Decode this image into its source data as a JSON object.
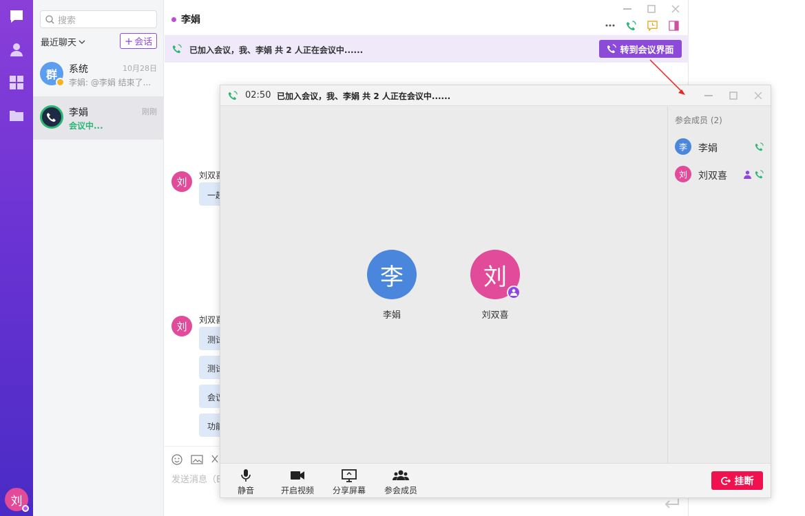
{
  "rail": {
    "me_avatar": "刘"
  },
  "chatlist": {
    "search_placeholder": "搜索",
    "recent_label": "最近聊天",
    "new_session_label": "会话",
    "conversations": [
      {
        "avatar": "群",
        "name": "系统",
        "time": "10月28日",
        "preview": "李娟: @李娟 结束了..."
      },
      {
        "avatar": "",
        "name": "李娟",
        "time": "刚刚",
        "preview": "会议中..."
      }
    ]
  },
  "chat": {
    "title": "李娟",
    "banner_text": "已加入会议，我、李娟 共 2 人正在会议中......",
    "goto_meeting_label": "转到会议界面",
    "messages": [
      {
        "avatar": "刘",
        "sender": "刘双喜",
        "bubbles": [
          "一起"
        ]
      },
      {
        "avatar": "刘",
        "sender": "刘双喜",
        "bubbles": [
          "测试",
          "测试",
          "会议",
          "功能"
        ]
      }
    ],
    "composer_placeholder": "发送消息（E"
  },
  "meeting": {
    "timer": "02:50",
    "status_text": "已加入会议，我、李娟 共 2 人正在会议中......",
    "participants": [
      {
        "avatar": "李",
        "name": "李娟",
        "color": "#4a86dc"
      },
      {
        "avatar": "刘",
        "name": "刘双喜",
        "color": "#e24a9a"
      }
    ],
    "members_title": "参会成员 (2)",
    "members": [
      {
        "avatar": "李",
        "name": "李娟",
        "color": "#4a86dc"
      },
      {
        "avatar": "刘",
        "name": "刘双喜",
        "color": "#e24a9a"
      }
    ],
    "toolbar": {
      "mute": "静音",
      "video": "开启视频",
      "share": "分享屏幕",
      "members": "参会成员",
      "hangup": "挂断"
    }
  },
  "colors": {
    "accent": "#8c4ad9",
    "hangup": "#f0124f",
    "online_green": "#2bb673",
    "arrow": "#e8261f"
  }
}
